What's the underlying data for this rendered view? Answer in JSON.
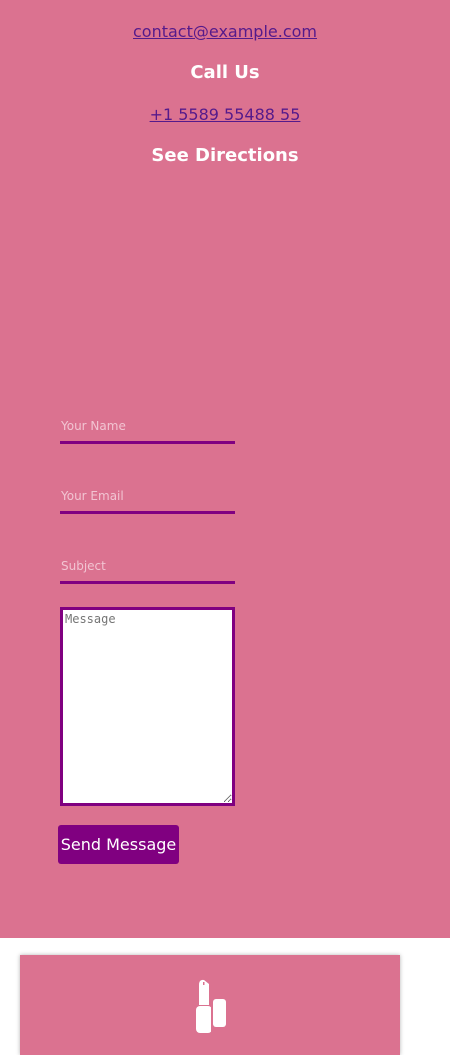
{
  "contact": {
    "email": "contact@example.com",
    "call_heading": "Call Us",
    "phone": "+1 5589 55488 55",
    "directions_heading": "See Directions"
  },
  "form": {
    "name_placeholder": "Your Name",
    "email_placeholder": "Your Email",
    "subject_placeholder": "Subject",
    "message_placeholder": "Message",
    "send_label": "Send Message"
  },
  "footer": {
    "icon": "lipstick-icon"
  },
  "colors": {
    "background": "#db7290",
    "accent": "#800080",
    "link": "#551a8b",
    "heading": "#ffffff"
  }
}
